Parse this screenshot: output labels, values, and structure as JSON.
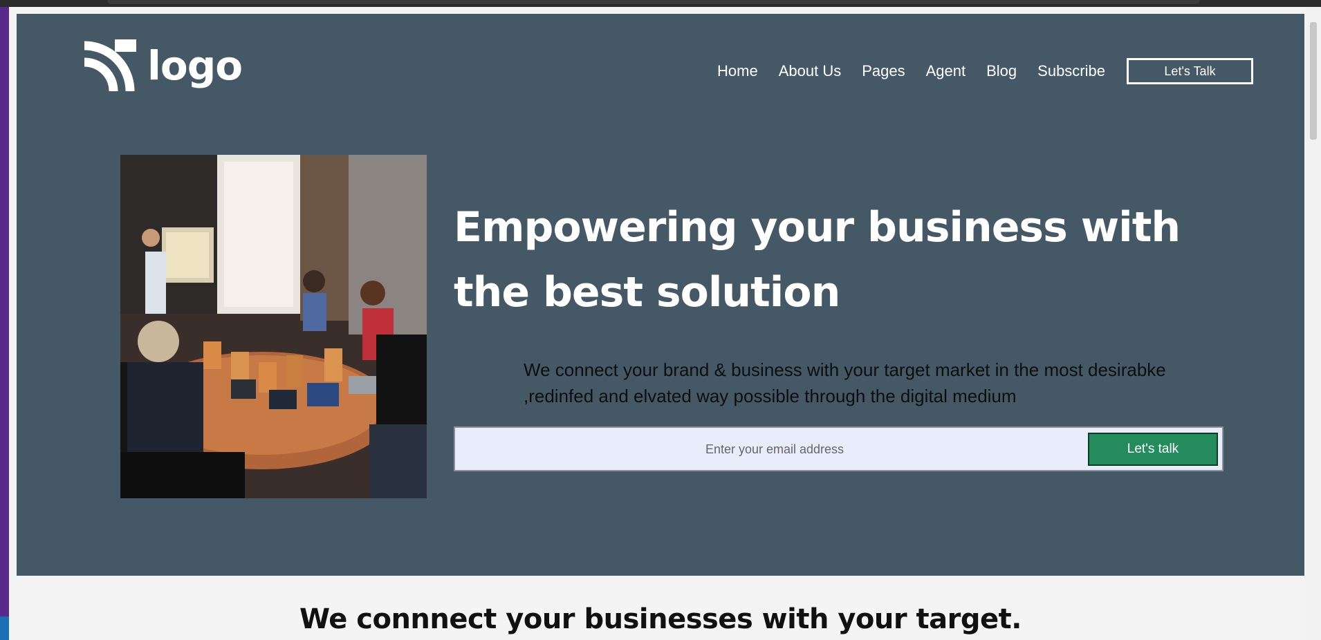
{
  "brand": {
    "logo_text": "logo"
  },
  "nav": {
    "items": [
      {
        "label": "Home"
      },
      {
        "label": "About Us"
      },
      {
        "label": "Pages"
      },
      {
        "label": "Agent"
      },
      {
        "label": "Blog"
      },
      {
        "label": "Subscribe"
      }
    ],
    "cta_label": "Let's Talk"
  },
  "hero": {
    "headline": "Empowering your business with the best solution",
    "subtext": "We connect your brand & business with your target market in the most desirabke ,redinfed and elvated way possible through the digital medium",
    "email_placeholder": "Enter your email address",
    "email_value": "",
    "cta_label": "Let's talk"
  },
  "section": {
    "title": "We connnect your businesses with your target."
  },
  "colors": {
    "hero_bg": "#445866",
    "cta_green": "#238b5c",
    "input_bg": "#e8ecfb"
  }
}
